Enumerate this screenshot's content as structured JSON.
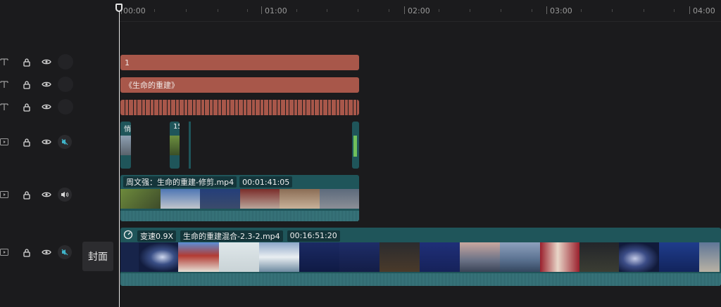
{
  "ruler": {
    "labels": [
      "00:00",
      "01:00",
      "02:00",
      "03:00",
      "04:00"
    ]
  },
  "tracks": {
    "text1": {
      "clip_label": "1"
    },
    "text2": {
      "clip_label": "《生命的重建》"
    },
    "video_upper": {
      "clip1_label": "悄",
      "clip2_label": "15"
    },
    "audio_video": {
      "clip_title": "周文强：生命的重建-修剪.mp4",
      "clip_duration": "00:01:41:05"
    },
    "main": {
      "speed_label": "变速0.9X",
      "clip_title": "生命的重建混合-2.3-2.mp4",
      "clip_duration": "00:16:51:20"
    }
  },
  "cover": {
    "label": "封面"
  },
  "colors": {
    "text_clip": "#a8574a",
    "media_clip": "#1f555a",
    "background": "#1b1b1d",
    "playhead": "#e7e7e7"
  },
  "icons": [
    "text-track-icon",
    "video-track-icon",
    "lock-icon",
    "eye-icon",
    "mute-icon",
    "volume-icon",
    "speed-icon"
  ]
}
